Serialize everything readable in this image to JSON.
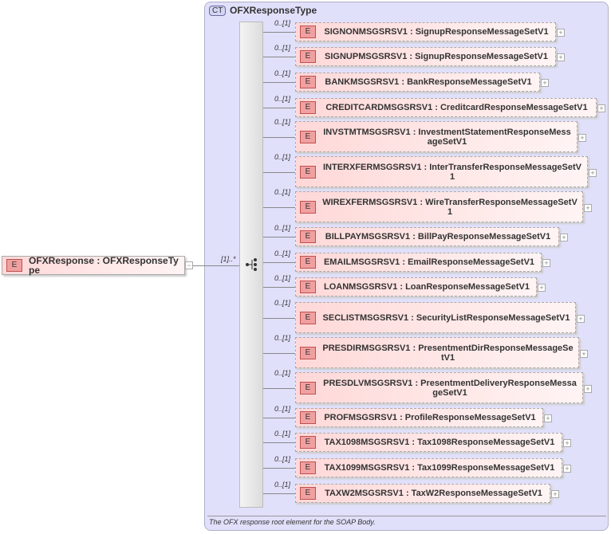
{
  "root": {
    "badge": "E",
    "name": "OFXResponse : OFXResponseType",
    "multiplicity": "[1]..*",
    "collapse": "−"
  },
  "complex_type": {
    "badge": "CT",
    "name": "OFXResponseType",
    "description": "The OFX response root element for the SOAP Body."
  },
  "elements": [
    {
      "badge": "E",
      "name": "SIGNONMSGSRSV1 : SignupResponseMessageSetV1",
      "mult": "0..[1]",
      "expand": "+"
    },
    {
      "badge": "E",
      "name": "SIGNUPMSGSRSV1 : SignupResponseMessageSetV1",
      "mult": "0..[1]",
      "expand": "+"
    },
    {
      "badge": "E",
      "name": "BANKMSGSRSV1 : BankResponseMessageSetV1",
      "mult": "0..[1]",
      "expand": "+"
    },
    {
      "badge": "E",
      "name": "CREDITCARDMSGSRSV1 : CreditcardResponseMessageSetV1",
      "mult": "0..[1]",
      "expand": "+"
    },
    {
      "badge": "E",
      "name": "INVSTMTMSGSRSV1 : InvestmentStatementResponseMessageSetV1",
      "mult": "0..[1]",
      "expand": "+"
    },
    {
      "badge": "E",
      "name": "INTERXFERMSGSRSV1 : InterTransferResponseMessageSetV1",
      "mult": "0..[1]",
      "expand": "+"
    },
    {
      "badge": "E",
      "name": "WIREXFERMSGSRSV1 : WireTransferResponseMessageSetV1",
      "mult": "0..[1]",
      "expand": "+"
    },
    {
      "badge": "E",
      "name": "BILLPAYMSGSRSV1 : BillPayResponseMessageSetV1",
      "mult": "0..[1]",
      "expand": "+"
    },
    {
      "badge": "E",
      "name": "EMAILMSGSRSV1 : EmailResponseMessageSetV1",
      "mult": "0..[1]",
      "expand": "+"
    },
    {
      "badge": "E",
      "name": "LOANMSGSRSV1 : LoanResponseMessageSetV1",
      "mult": "0..[1]",
      "expand": "+"
    },
    {
      "badge": "E",
      "name": "SECLISTMSGSRSV1 : SecurityListResponseMessageSetV1",
      "mult": "0..[1]",
      "expand": "+"
    },
    {
      "badge": "E",
      "name": "PRESDIRMSGSRSV1 : PresentmentDirResponseMessageSetV1",
      "mult": "0..[1]",
      "expand": "+"
    },
    {
      "badge": "E",
      "name": "PRESDLVMSGSRSV1 : PresentmentDeliveryResponseMessageSetV1",
      "mult": "0..[1]",
      "expand": "+"
    },
    {
      "badge": "E",
      "name": "PROFMSGSRSV1 : ProfileResponseMessageSetV1",
      "mult": "0..[1]",
      "expand": "+"
    },
    {
      "badge": "E",
      "name": "TAX1098MSGSRSV1 : Tax1098ResponseMessageSetV1",
      "mult": "0..[1]",
      "expand": "+"
    },
    {
      "badge": "E",
      "name": "TAX1099MSGSRSV1 : Tax1099ResponseMessageSetV1",
      "mult": "0..[1]",
      "expand": "+"
    },
    {
      "badge": "E",
      "name": "TAXW2MSGSRSV1 : TaxW2ResponseMessageSetV1",
      "mult": "0..[1]",
      "expand": "+"
    }
  ]
}
